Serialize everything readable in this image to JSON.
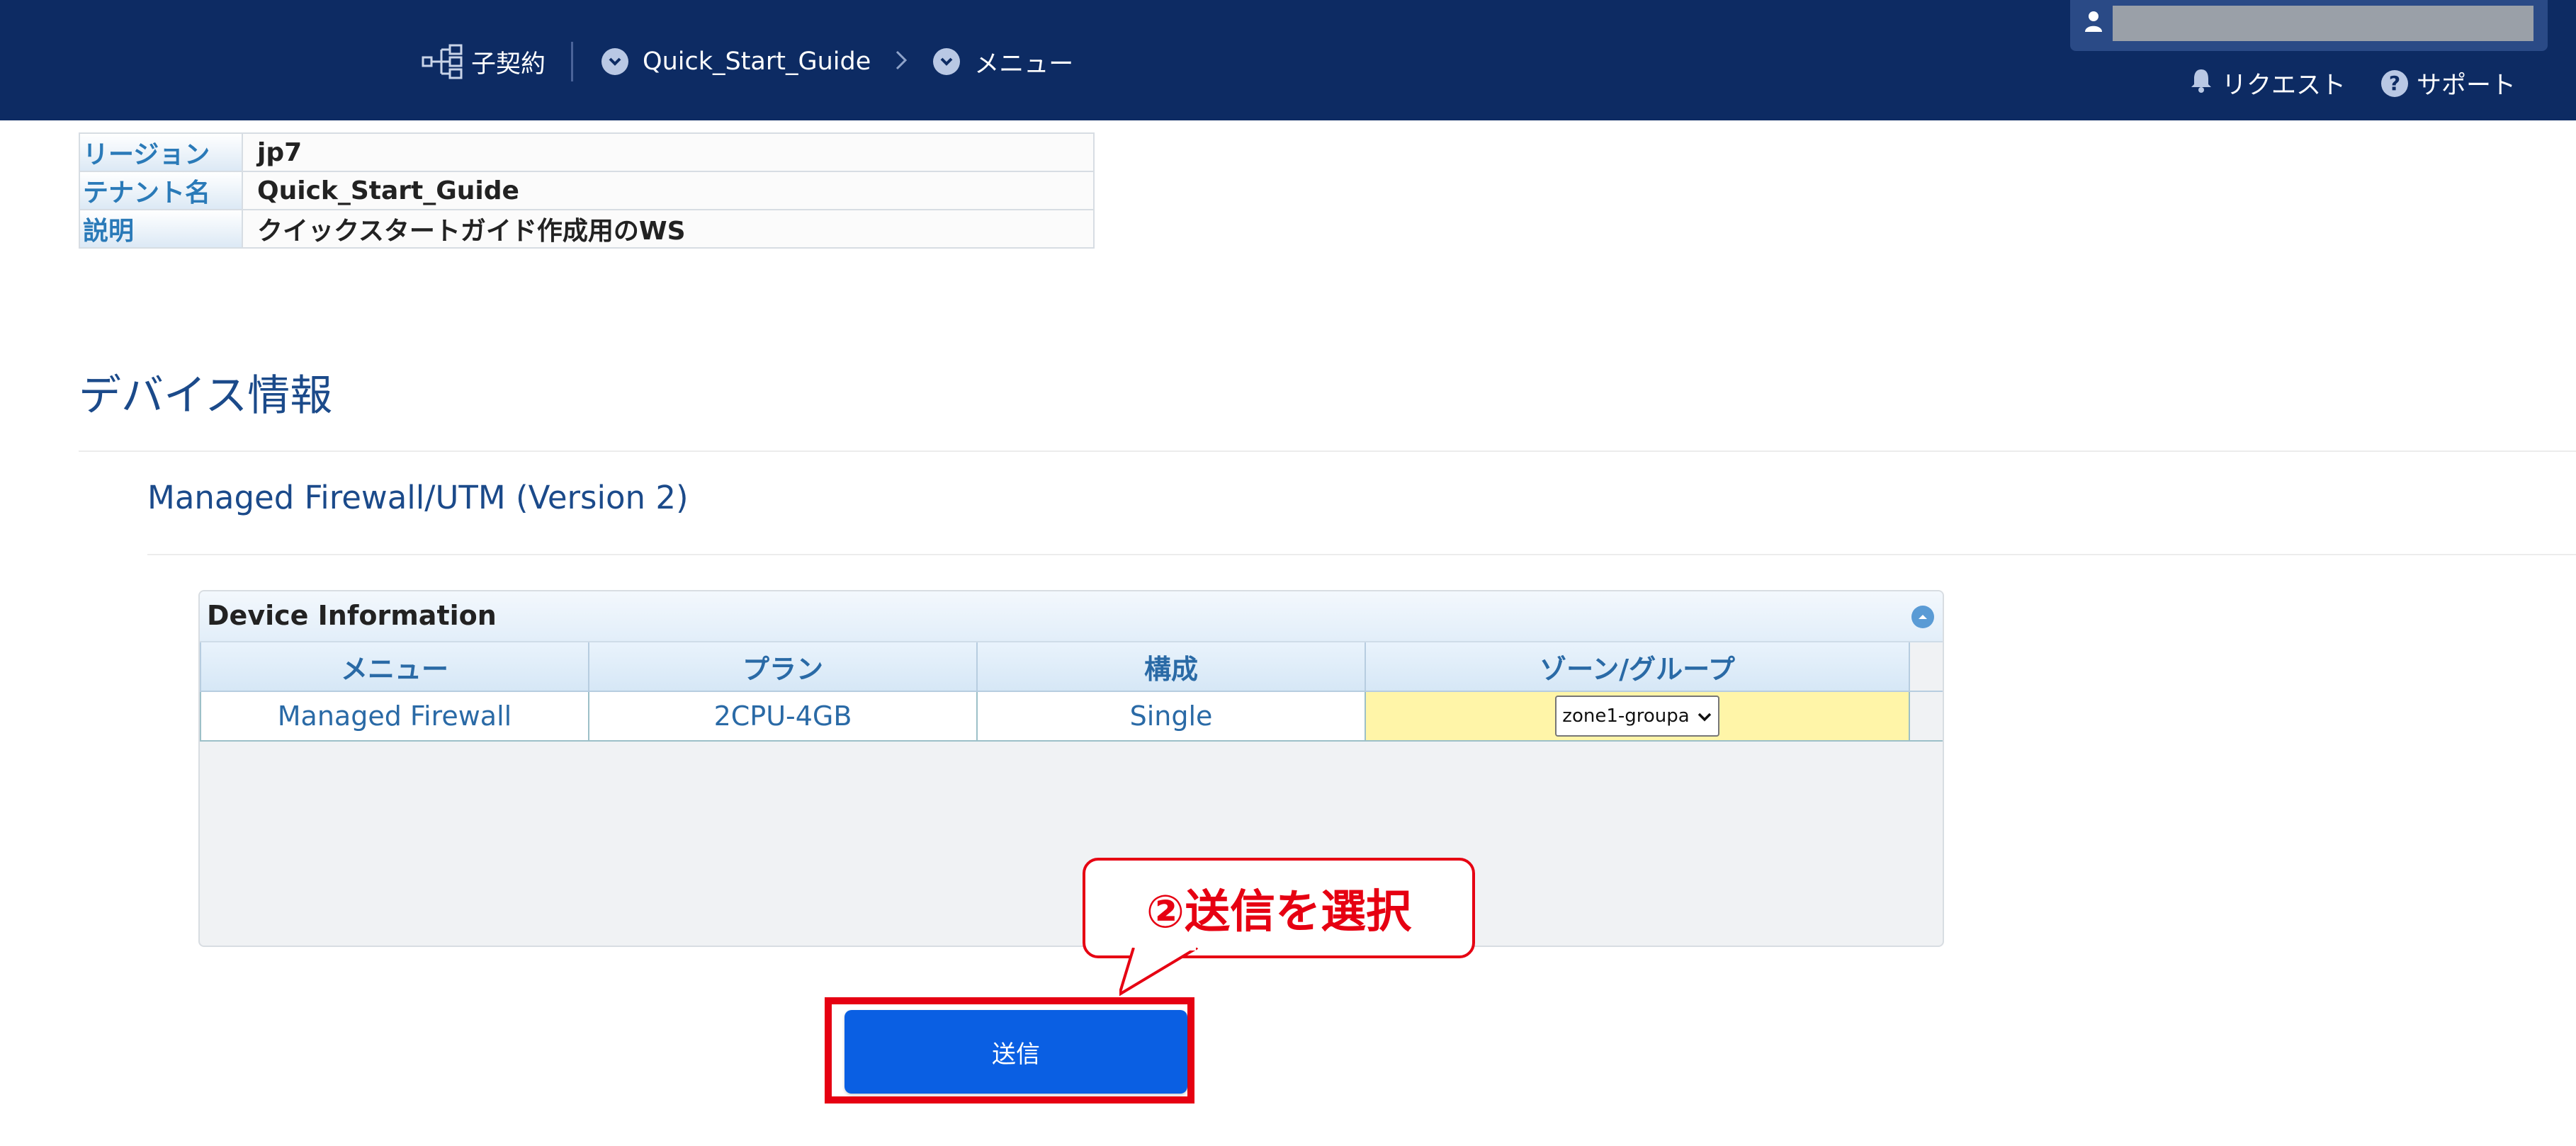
{
  "header": {
    "breadcrumb": [
      {
        "label": "子契約",
        "icon": "hierarchy-icon"
      },
      {
        "label": "Quick_Start_Guide",
        "icon": "chevron-circle-icon"
      },
      {
        "label": "メニュー",
        "icon": "chevron-circle-icon"
      }
    ],
    "user_name": "",
    "links": {
      "request": "リクエスト",
      "support": "サポート"
    },
    "colors": {
      "bar": "#0d2b63"
    }
  },
  "info": [
    {
      "key": "リージョン",
      "value": "jp7"
    },
    {
      "key": "テナント名",
      "value": "Quick_Start_Guide"
    },
    {
      "key": "説明",
      "value": "クイックスタートガイド作成用のWS"
    }
  ],
  "section": {
    "title": "デバイス情報",
    "subtitle": "Managed Firewall/UTM (Version 2)"
  },
  "device_panel": {
    "title": "Device Information",
    "columns": [
      "メニュー",
      "プラン",
      "構成",
      "ゾーン/グループ"
    ],
    "rows": [
      {
        "menu": "Managed Firewall",
        "plan": "2CPU-4GB",
        "config": "Single",
        "zone": "zone1-groupa"
      }
    ]
  },
  "callout": {
    "text": "②送信を選択",
    "color": "#e60012"
  },
  "submit": {
    "label": "送信",
    "color": "#0a5fe3"
  }
}
